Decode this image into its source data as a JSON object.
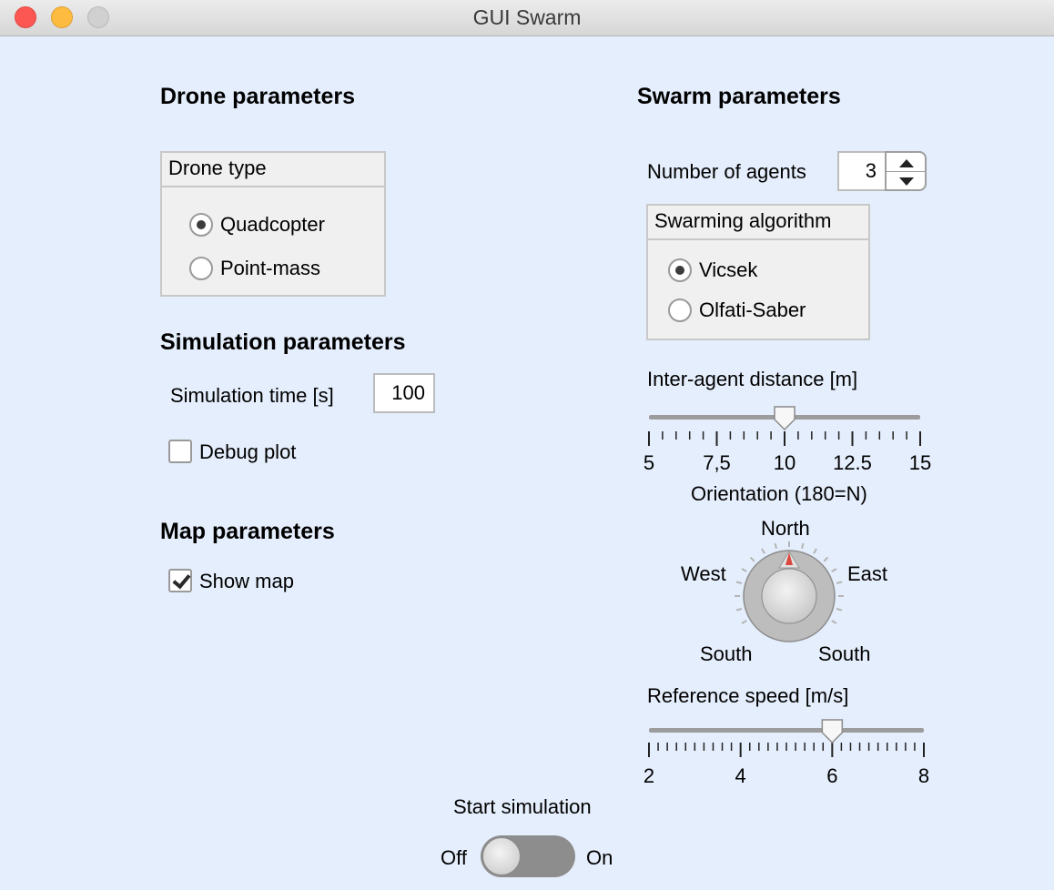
{
  "window": {
    "title": "GUI Swarm"
  },
  "drone": {
    "heading": "Drone parameters",
    "panel_title": "Drone type",
    "options": [
      {
        "label": "Quadcopter",
        "selected": true
      },
      {
        "label": "Point-mass",
        "selected": false
      }
    ]
  },
  "simulation": {
    "heading": "Simulation parameters",
    "time_label": "Simulation time [s]",
    "time_value": "100",
    "debug_label": "Debug plot",
    "debug_checked": false
  },
  "map": {
    "heading": "Map parameters",
    "show_map_label": "Show map",
    "show_map_checked": true
  },
  "swarm": {
    "heading": "Swarm parameters",
    "agents_label": "Number of agents",
    "agents_value": "3",
    "algorithm_title": "Swarming algorithm",
    "algorithms": [
      {
        "label": "Vicsek",
        "selected": true
      },
      {
        "label": "Olfati-Saber",
        "selected": false
      }
    ],
    "distance": {
      "label": "Inter-agent distance [m]",
      "min": 5,
      "max": 15,
      "value": 10,
      "tick_labels": [
        "5",
        "7,5",
        "10",
        "12.5",
        "15"
      ]
    },
    "orientation": {
      "label": "Orientation (180=N)",
      "dir_north": "North",
      "dir_west": "West",
      "dir_east": "East",
      "dir_south_left": "South",
      "dir_south_right": "South",
      "value": 180
    },
    "speed": {
      "label": "Reference speed [m/s]",
      "min": 2,
      "max": 8,
      "value": 6,
      "tick_labels": [
        "2",
        "4",
        "6",
        "8"
      ]
    }
  },
  "start": {
    "label": "Start simulation",
    "off_label": "Off",
    "on_label": "On",
    "state": "Off"
  },
  "colors": {
    "background": "#e5eefc",
    "panel": "#f0f0f0",
    "needle": "#d9473e",
    "close": "#fc5753",
    "minimize": "#fdbc40",
    "zoom": "#d0d0d0"
  }
}
